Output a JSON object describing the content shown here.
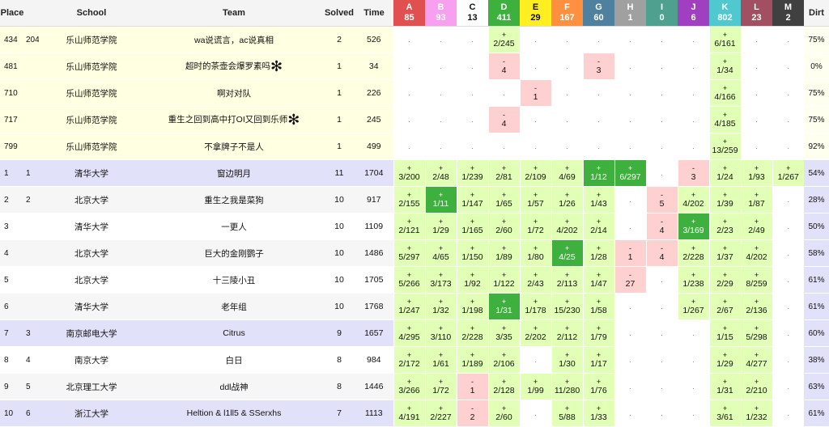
{
  "headers": {
    "place": "Place",
    "school": "School",
    "team": "Team",
    "solved": "Solved",
    "time": "Time",
    "dirt": "Dirt"
  },
  "problems": [
    {
      "letter": "A",
      "count": "85",
      "color": "#e05050",
      "text": "#fff"
    },
    {
      "letter": "B",
      "count": "93",
      "color": "#f7a0f0",
      "text": "#fff"
    },
    {
      "letter": "C",
      "count": "13",
      "color": "#ffffff",
      "text": "#111"
    },
    {
      "letter": "D",
      "count": "411",
      "color": "#3db03d",
      "text": "#fff"
    },
    {
      "letter": "E",
      "count": "29",
      "color": "#ffee22",
      "text": "#111"
    },
    {
      "letter": "F",
      "count": "167",
      "color": "#ff9040",
      "text": "#fff"
    },
    {
      "letter": "G",
      "count": "60",
      "color": "#5080a0",
      "text": "#fff"
    },
    {
      "letter": "H",
      "count": "1",
      "color": "#a0a0a0",
      "text": "#fff"
    },
    {
      "letter": "I",
      "count": "0",
      "color": "#50a090",
      "text": "#fff"
    },
    {
      "letter": "J",
      "count": "6",
      "color": "#a040c0",
      "text": "#fff"
    },
    {
      "letter": "K",
      "count": "802",
      "color": "#50c8d0",
      "text": "#fff"
    },
    {
      "letter": "L",
      "count": "23",
      "color": "#a05060",
      "text": "#fff"
    },
    {
      "letter": "M",
      "count": "2",
      "color": "#404040",
      "text": "#fff"
    }
  ],
  "rows": [
    {
      "place": "434",
      "grank": "204",
      "school": "乐山师范学院",
      "team": "wa说谎言，ac说真相",
      "star": "",
      "solved": "2",
      "time": "526",
      "dirt": "75%",
      "group": "g0",
      "cells": [
        [
          "e",
          "."
        ],
        [
          "e",
          "."
        ],
        [
          "e",
          "."
        ],
        [
          "ok",
          "+",
          "2/245"
        ],
        [
          "e",
          "."
        ],
        [
          "e",
          "."
        ],
        [
          "e",
          "."
        ],
        [
          "e",
          "."
        ],
        [
          "e",
          "."
        ],
        [
          "e",
          "."
        ],
        [
          "ok",
          "+",
          "6/161"
        ],
        [
          "e",
          "."
        ],
        [
          "e",
          "."
        ]
      ]
    },
    {
      "place": "481",
      "grank": "",
      "school": "乐山师范学院",
      "team": "超时的茶壶会爆罗素吗",
      "star": "✻",
      "solved": "1",
      "time": "34",
      "dirt": "0%",
      "group": "g0",
      "cells": [
        [
          "e",
          "."
        ],
        [
          "e",
          "."
        ],
        [
          "e",
          "."
        ],
        [
          "fail",
          "-",
          "4"
        ],
        [
          "e",
          "."
        ],
        [
          "e",
          "."
        ],
        [
          "fail",
          "-",
          "3"
        ],
        [
          "e",
          "."
        ],
        [
          "e",
          "."
        ],
        [
          "e",
          "."
        ],
        [
          "ok",
          "+",
          "1/34"
        ],
        [
          "e",
          "."
        ],
        [
          "e",
          "."
        ]
      ]
    },
    {
      "place": "710",
      "grank": "",
      "school": "乐山师范学院",
      "team": "啊对对队",
      "star": "",
      "solved": "1",
      "time": "226",
      "dirt": "75%",
      "group": "g0",
      "cells": [
        [
          "e",
          "."
        ],
        [
          "e",
          "."
        ],
        [
          "e",
          "."
        ],
        [
          "e",
          "."
        ],
        [
          "fail",
          "-",
          "1"
        ],
        [
          "e",
          "."
        ],
        [
          "e",
          "."
        ],
        [
          "e",
          "."
        ],
        [
          "e",
          "."
        ],
        [
          "e",
          "."
        ],
        [
          "ok",
          "+",
          "4/166"
        ],
        [
          "e",
          "."
        ],
        [
          "e",
          "."
        ]
      ]
    },
    {
      "place": "717",
      "grank": "",
      "school": "乐山师范学院",
      "team": "重生之回到高中打OI又回到乐师",
      "star": "✻",
      "solved": "1",
      "time": "245",
      "dirt": "75%",
      "group": "g0",
      "cells": [
        [
          "e",
          "."
        ],
        [
          "e",
          "."
        ],
        [
          "e",
          "."
        ],
        [
          "fail",
          "-",
          "4"
        ],
        [
          "e",
          "."
        ],
        [
          "e",
          "."
        ],
        [
          "e",
          "."
        ],
        [
          "e",
          "."
        ],
        [
          "e",
          "."
        ],
        [
          "e",
          "."
        ],
        [
          "ok",
          "+",
          "4/185"
        ],
        [
          "e",
          "."
        ],
        [
          "e",
          "."
        ]
      ]
    },
    {
      "place": "799",
      "grank": "",
      "school": "乐山师范学院",
      "team": "不拿牌子不是人",
      "star": "",
      "solved": "1",
      "time": "499",
      "dirt": "92%",
      "group": "g0",
      "cells": [
        [
          "e",
          "."
        ],
        [
          "e",
          "."
        ],
        [
          "e",
          "."
        ],
        [
          "e",
          "."
        ],
        [
          "e",
          "."
        ],
        [
          "e",
          "."
        ],
        [
          "e",
          "."
        ],
        [
          "e",
          "."
        ],
        [
          "e",
          "."
        ],
        [
          "e",
          "."
        ],
        [
          "ok",
          "+",
          "13/259"
        ],
        [
          "e",
          "."
        ],
        [
          "e",
          "."
        ]
      ]
    },
    {
      "place": "1",
      "grank": "1",
      "school": "清华大学",
      "team": "窗边明月",
      "star": "",
      "solved": "11",
      "time": "1704",
      "dirt": "54%",
      "group": "g1",
      "cells": [
        [
          "ok",
          "+",
          "3/200"
        ],
        [
          "ok",
          "+",
          "2/48"
        ],
        [
          "ok",
          "+",
          "1/239"
        ],
        [
          "ok",
          "+",
          "2/81"
        ],
        [
          "ok",
          "+",
          "2/109"
        ],
        [
          "ok",
          "+",
          "4/69"
        ],
        [
          "first",
          "+",
          "1/12"
        ],
        [
          "first",
          "+",
          "6/297"
        ],
        [
          "e",
          "."
        ],
        [
          "fail",
          "-",
          "3"
        ],
        [
          "ok",
          "+",
          "1/24"
        ],
        [
          "ok",
          "+",
          "1/93"
        ],
        [
          "ok",
          "+",
          "1/267"
        ]
      ]
    },
    {
      "place": "2",
      "grank": "2",
      "school": "北京大学",
      "team": "重生之我是菜狗",
      "star": "",
      "solved": "10",
      "time": "917",
      "dirt": "28%",
      "group": "g2",
      "cells": [
        [
          "ok",
          "+",
          "2/155"
        ],
        [
          "first",
          "+",
          "1/11"
        ],
        [
          "ok",
          "+",
          "1/147"
        ],
        [
          "ok",
          "+",
          "1/65"
        ],
        [
          "ok",
          "+",
          "1/57"
        ],
        [
          "ok",
          "+",
          "1/26"
        ],
        [
          "ok",
          "+",
          "1/43"
        ],
        [
          "e",
          "."
        ],
        [
          "fail",
          "-",
          "5"
        ],
        [
          "ok",
          "+",
          "4/202"
        ],
        [
          "ok",
          "+",
          "1/39"
        ],
        [
          "ok",
          "+",
          "1/87"
        ],
        [
          "e",
          "."
        ]
      ]
    },
    {
      "place": "3",
      "grank": "",
      "school": "清华大学",
      "team": "一更人",
      "star": "",
      "solved": "10",
      "time": "1109",
      "dirt": "50%",
      "group": "g3",
      "cells": [
        [
          "ok",
          "+",
          "2/121"
        ],
        [
          "ok",
          "+",
          "1/29"
        ],
        [
          "ok",
          "+",
          "1/165"
        ],
        [
          "ok",
          "+",
          "2/60"
        ],
        [
          "ok",
          "+",
          "1/72"
        ],
        [
          "ok",
          "+",
          "4/202"
        ],
        [
          "ok",
          "+",
          "2/14"
        ],
        [
          "e",
          "."
        ],
        [
          "fail",
          "-",
          "4"
        ],
        [
          "first",
          "+",
          "3/169"
        ],
        [
          "ok",
          "+",
          "2/23"
        ],
        [
          "ok",
          "+",
          "2/49"
        ],
        [
          "e",
          "."
        ]
      ]
    },
    {
      "place": "4",
      "grank": "",
      "school": "北京大学",
      "team": "巨大的金刚鹦子",
      "star": "",
      "solved": "10",
      "time": "1486",
      "dirt": "58%",
      "group": "g2",
      "cells": [
        [
          "ok",
          "+",
          "5/297"
        ],
        [
          "ok",
          "+",
          "4/65"
        ],
        [
          "ok",
          "+",
          "1/150"
        ],
        [
          "ok",
          "+",
          "1/89"
        ],
        [
          "ok",
          "+",
          "1/80"
        ],
        [
          "first",
          "+",
          "4/25"
        ],
        [
          "ok",
          "+",
          "1/28"
        ],
        [
          "fail",
          "-",
          "1"
        ],
        [
          "fail",
          "-",
          "4"
        ],
        [
          "ok",
          "+",
          "2/228"
        ],
        [
          "ok",
          "+",
          "1/37"
        ],
        [
          "ok",
          "+",
          "4/202"
        ],
        [
          "e",
          "."
        ]
      ]
    },
    {
      "place": "5",
      "grank": "",
      "school": "北京大学",
      "team": "十三陵小丑",
      "star": "",
      "solved": "10",
      "time": "1705",
      "dirt": "61%",
      "group": "g3",
      "cells": [
        [
          "ok",
          "+",
          "5/266"
        ],
        [
          "ok",
          "+",
          "3/173"
        ],
        [
          "ok",
          "+",
          "1/92"
        ],
        [
          "ok",
          "+",
          "1/122"
        ],
        [
          "ok",
          "+",
          "2/43"
        ],
        [
          "ok",
          "+",
          "2/113"
        ],
        [
          "ok",
          "+",
          "1/47"
        ],
        [
          "fail",
          "-",
          "27"
        ],
        [
          "e",
          "."
        ],
        [
          "ok",
          "+",
          "1/238"
        ],
        [
          "ok",
          "+",
          "2/29"
        ],
        [
          "ok",
          "+",
          "8/259"
        ],
        [
          "e",
          "."
        ]
      ]
    },
    {
      "place": "6",
      "grank": "",
      "school": "清华大学",
      "team": "老年组",
      "star": "",
      "solved": "10",
      "time": "1768",
      "dirt": "61%",
      "group": "g2",
      "cells": [
        [
          "ok",
          "+",
          "1/247"
        ],
        [
          "ok",
          "+",
          "1/32"
        ],
        [
          "ok",
          "+",
          "1/198"
        ],
        [
          "first",
          "+",
          "1/31"
        ],
        [
          "ok",
          "+",
          "1/178"
        ],
        [
          "ok",
          "+",
          "15/230"
        ],
        [
          "ok",
          "+",
          "1/58"
        ],
        [
          "e",
          "."
        ],
        [
          "e",
          "."
        ],
        [
          "ok",
          "+",
          "1/267"
        ],
        [
          "ok",
          "+",
          "2/67"
        ],
        [
          "ok",
          "+",
          "2/136"
        ],
        [
          "e",
          "."
        ]
      ]
    },
    {
      "place": "7",
      "grank": "3",
      "school": "南京邮电大学",
      "team": "Citrus",
      "star": "",
      "solved": "9",
      "time": "1657",
      "dirt": "60%",
      "group": "g1",
      "cells": [
        [
          "ok",
          "+",
          "4/295"
        ],
        [
          "ok",
          "+",
          "3/110"
        ],
        [
          "ok",
          "+",
          "2/228"
        ],
        [
          "ok",
          "+",
          "3/35"
        ],
        [
          "ok",
          "+",
          "2/202"
        ],
        [
          "ok",
          "+",
          "2/112"
        ],
        [
          "ok",
          "+",
          "1/79"
        ],
        [
          "e",
          "."
        ],
        [
          "e",
          "."
        ],
        [
          "e",
          "."
        ],
        [
          "ok",
          "+",
          "1/15"
        ],
        [
          "ok",
          "+",
          "5/298"
        ],
        [
          "e",
          "."
        ]
      ]
    },
    {
      "place": "8",
      "grank": "4",
      "school": "南京大学",
      "team": "白日",
      "star": "",
      "solved": "8",
      "time": "984",
      "dirt": "38%",
      "group": "g3",
      "cells": [
        [
          "ok",
          "+",
          "2/172"
        ],
        [
          "ok",
          "+",
          "1/61"
        ],
        [
          "ok",
          "+",
          "1/189"
        ],
        [
          "ok",
          "+",
          "2/106"
        ],
        [
          "e",
          "."
        ],
        [
          "ok",
          "+",
          "1/30"
        ],
        [
          "ok",
          "+",
          "1/17"
        ],
        [
          "e",
          "."
        ],
        [
          "e",
          "."
        ],
        [
          "e",
          "."
        ],
        [
          "ok",
          "+",
          "1/29"
        ],
        [
          "ok",
          "+",
          "4/277"
        ],
        [
          "e",
          "."
        ]
      ]
    },
    {
      "place": "9",
      "grank": "5",
      "school": "北京理工大学",
      "team": "ddl战神",
      "star": "",
      "solved": "8",
      "time": "1446",
      "dirt": "63%",
      "group": "g2",
      "cells": [
        [
          "ok",
          "+",
          "3/266"
        ],
        [
          "ok",
          "+",
          "1/72"
        ],
        [
          "fail",
          "-",
          "1"
        ],
        [
          "ok",
          "+",
          "2/128"
        ],
        [
          "ok",
          "+",
          "1/99"
        ],
        [
          "ok",
          "+",
          "11/280"
        ],
        [
          "ok",
          "+",
          "1/76"
        ],
        [
          "e",
          "."
        ],
        [
          "e",
          "."
        ],
        [
          "e",
          "."
        ],
        [
          "ok",
          "+",
          "1/31"
        ],
        [
          "ok",
          "+",
          "2/210"
        ],
        [
          "e",
          "."
        ]
      ]
    },
    {
      "place": "10",
      "grank": "6",
      "school": "浙江大学",
      "team": "Heltion & l1ll5 & SSerxhs",
      "star": "",
      "solved": "7",
      "time": "1113",
      "dirt": "61%",
      "group": "g1",
      "cells": [
        [
          "ok",
          "+",
          "4/191"
        ],
        [
          "ok",
          "+",
          "2/227"
        ],
        [
          "fail",
          "-",
          "2"
        ],
        [
          "ok",
          "+",
          "2/60"
        ],
        [
          "e",
          "."
        ],
        [
          "ok",
          "+",
          "5/88"
        ],
        [
          "ok",
          "+",
          "1/33"
        ],
        [
          "e",
          "."
        ],
        [
          "e",
          "."
        ],
        [
          "e",
          "."
        ],
        [
          "ok",
          "+",
          "3/61"
        ],
        [
          "ok",
          "+",
          "1/232"
        ],
        [
          "e",
          "."
        ]
      ]
    }
  ]
}
